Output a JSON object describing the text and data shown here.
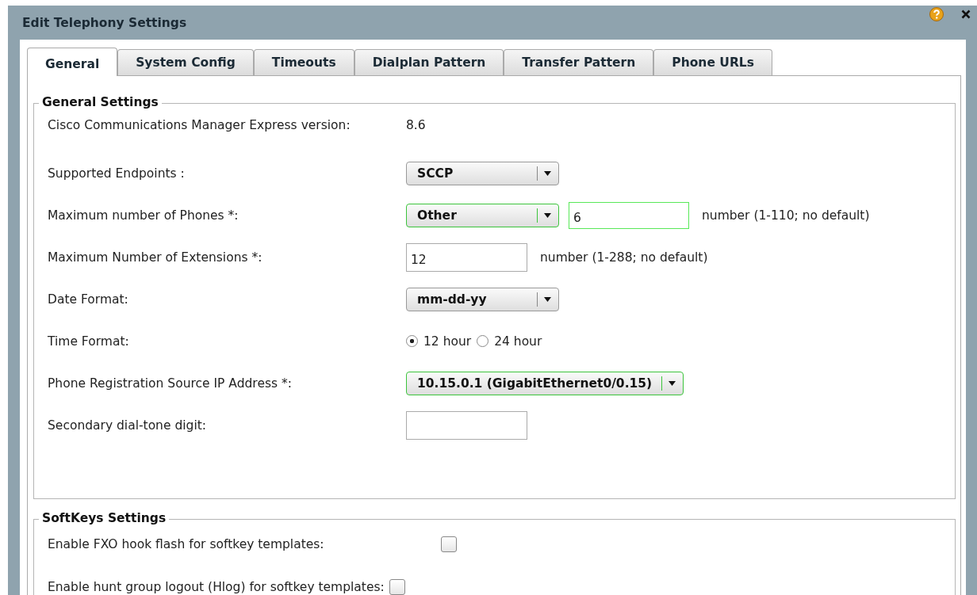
{
  "window": {
    "title": "Edit Telephony Settings"
  },
  "tabs": [
    {
      "label": "General",
      "selected": true
    },
    {
      "label": "System Config",
      "selected": false
    },
    {
      "label": "Timeouts",
      "selected": false
    },
    {
      "label": "Dialplan Pattern",
      "selected": false
    },
    {
      "label": "Transfer Pattern",
      "selected": false
    },
    {
      "label": "Phone URLs",
      "selected": false
    }
  ],
  "general_settings": {
    "title": "General Settings",
    "rows": [
      {
        "kind": "text",
        "label": "Cisco Communications Manager Express version:",
        "value": "8.6"
      },
      {
        "kind": "select",
        "label": "Supported Endpoints :",
        "select": {
          "value": "SCCP",
          "highlighted": false
        }
      },
      {
        "kind": "select_input",
        "label": "Maximum number of Phones *:",
        "select": {
          "value": "Other",
          "highlighted": true
        },
        "input": {
          "value": "6",
          "highlighted": true
        },
        "hint": "number (1-110; no default)"
      },
      {
        "kind": "input",
        "label": "Maximum Number of Extensions *:",
        "input": {
          "value": "12",
          "highlighted": false
        },
        "hint": "number (1-288; no default)"
      },
      {
        "kind": "select",
        "label": "Date Format:",
        "select": {
          "value": "mm-dd-yy",
          "highlighted": false
        }
      },
      {
        "kind": "radio",
        "label": "Time Format:",
        "options": [
          {
            "label": "12 hour",
            "selected": true
          },
          {
            "label": "24 hour",
            "selected": false
          }
        ]
      },
      {
        "kind": "select",
        "label": "Phone Registration Source IP Address *:",
        "select": {
          "value": "10.15.0.1 (GigabitEthernet0/0.15)",
          "highlighted": true
        }
      },
      {
        "kind": "input",
        "label": "Secondary dial-tone digit:",
        "input": {
          "highlighted": false
        }
      }
    ]
  },
  "softkeys_settings": {
    "title": "SoftKeys Settings",
    "rows": [
      {
        "kind": "checkbox",
        "label": "Enable FXO hook flash for softkey templates:",
        "checked": false
      },
      {
        "kind": "checkbox",
        "label": "Enable hunt group logout (Hlog) for softkey templates:",
        "checked": false
      }
    ]
  }
}
